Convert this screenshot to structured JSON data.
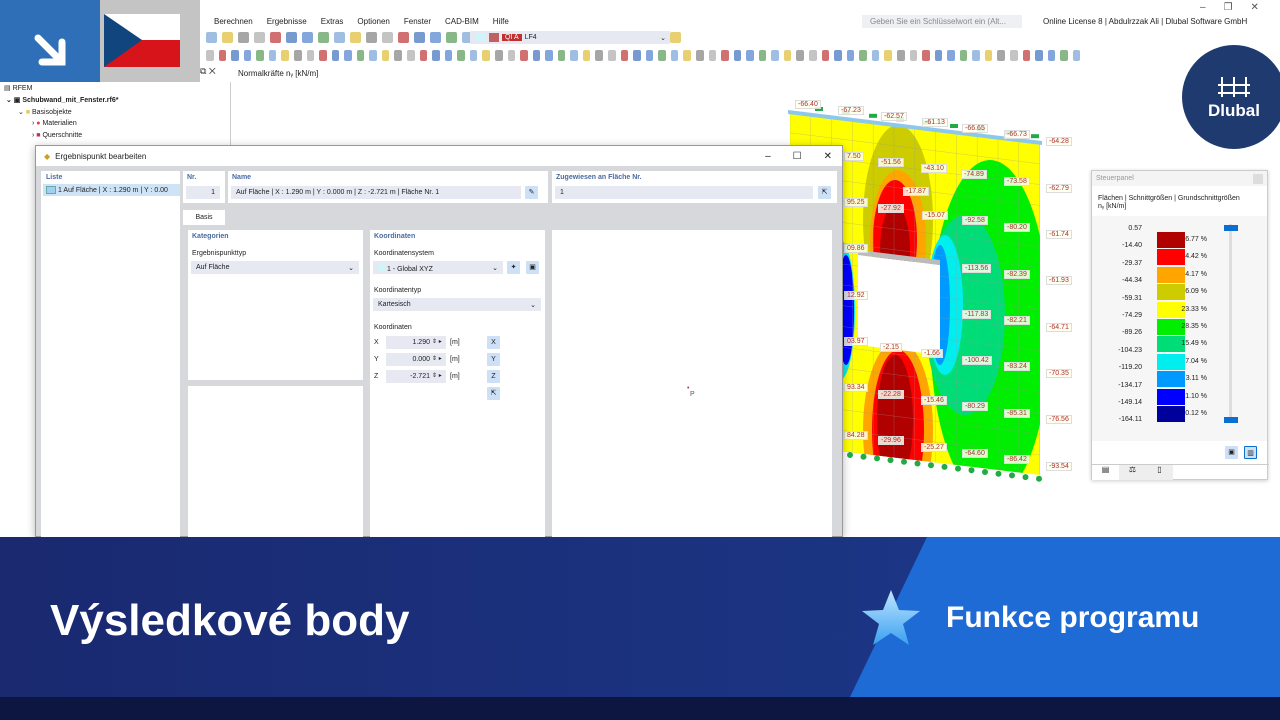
{
  "app": {
    "menu": [
      "Berechnen",
      "Ergebnisse",
      "Extras",
      "Optionen",
      "Fenster",
      "CAD-BIM",
      "Hilfe"
    ],
    "search_placeholder": "Geben Sie ein Schlüsselwort ein (Alt...",
    "license": "Online License 8 | Abdulrzzak Ali | Dlubal Software GmbH",
    "loadcase_badge": "QI A",
    "loadcase": "LF4",
    "view_title": "Normalkräfte nᵧ [kN/m]"
  },
  "navigator": {
    "root": "RFEM",
    "file": "Schubwand_mit_Fenster.rf6*",
    "group": "Basisobjekte",
    "items": [
      "Materialien",
      "Querschnitte"
    ]
  },
  "logo": {
    "text": "Dlubal",
    "color": "#1f3a6e"
  },
  "dialog": {
    "title": "Ergebnispunkt bearbeiten",
    "list_header": "Liste",
    "list_items": [
      "1  Auf Fläche | X : 1.290 m | Y : 0.00"
    ],
    "nr_label": "Nr.",
    "nr_value": "1",
    "name_label": "Name",
    "name_value": "Auf Fläche | X : 1.290 m | Y : 0.000 m | Z : -2.721 m | Fläche Nr. 1",
    "assigned_label": "Zugewiesen an Fläche Nr.",
    "assigned_value": "1",
    "tab": "Basis",
    "categories_header": "Kategorien",
    "type_label": "Ergebnispunkttyp",
    "type_value": "Auf Fläche",
    "coords_header": "Koordinaten",
    "cs_label": "Koordinatensystem",
    "cs_value": "1 - Global XYZ",
    "ctype_label": "Koordinatentyp",
    "ctype_value": "Kartesisch",
    "coords_label": "Koordinaten",
    "coords": [
      {
        "axis": "X",
        "value": "1.290",
        "unit": "[m]"
      },
      {
        "axis": "Y",
        "value": "0.000",
        "unit": "[m]"
      },
      {
        "axis": "Z",
        "value": "-2.721",
        "unit": "[m]"
      }
    ],
    "preview_point": "P"
  },
  "plot_labels": [
    "-66.40",
    "-67.23",
    "-62.57",
    "-61.13",
    "-66.65",
    "-66.73",
    "-64.28",
    "-62.79",
    "-61.74",
    "-61.93",
    "-64.71",
    "-70.35",
    "-76.56",
    "-93.54",
    "-51.56",
    "-43.10",
    "-74.89",
    "-73.58",
    "-17.87",
    "-27.92",
    "-15.07",
    "-92.58",
    "-80.20",
    "-113.56",
    "-82.39",
    "-117.83",
    "-82.21",
    "-2.15",
    "-1.66",
    "-100.42",
    "-83.24",
    "-22.28",
    "-15.46",
    "-80.29",
    "-85.31",
    "-29.96",
    "-25.27",
    "-64.60",
    "-86.42",
    "7.50",
    "95.25",
    "09.86",
    "12.92",
    "03.97",
    "93.34",
    "84.28"
  ],
  "steuerpanel": {
    "title": "Steuerpanel",
    "subtitle": "Flächen | Schnittgrößen | Grundschnittgrößen",
    "unit": "nᵧ [kN/m]",
    "values": [
      "0.57",
      "-14.40",
      "-29.37",
      "-44.34",
      "-59.31",
      "-74.29",
      "-89.26",
      "-104.23",
      "-119.20",
      "-134.17",
      "-149.14",
      "-164.11"
    ],
    "colors": [
      "#b00000",
      "#ff0000",
      "#ffa500",
      "#cccc00",
      "#ffff00",
      "#00ee00",
      "#00dd77",
      "#00eeee",
      "#0099ff",
      "#0000ff",
      "#00009a"
    ],
    "percents": [
      "6.77 %",
      "4.42 %",
      "4.17 %",
      "6.09 %",
      "23.33 %",
      "28.35 %",
      "15.49 %",
      "7.04 %",
      "3.11 %",
      "1.10 %",
      "0.12 %"
    ]
  },
  "banner": {
    "title": "Výsledkové body",
    "feature": "Funkce programu"
  }
}
